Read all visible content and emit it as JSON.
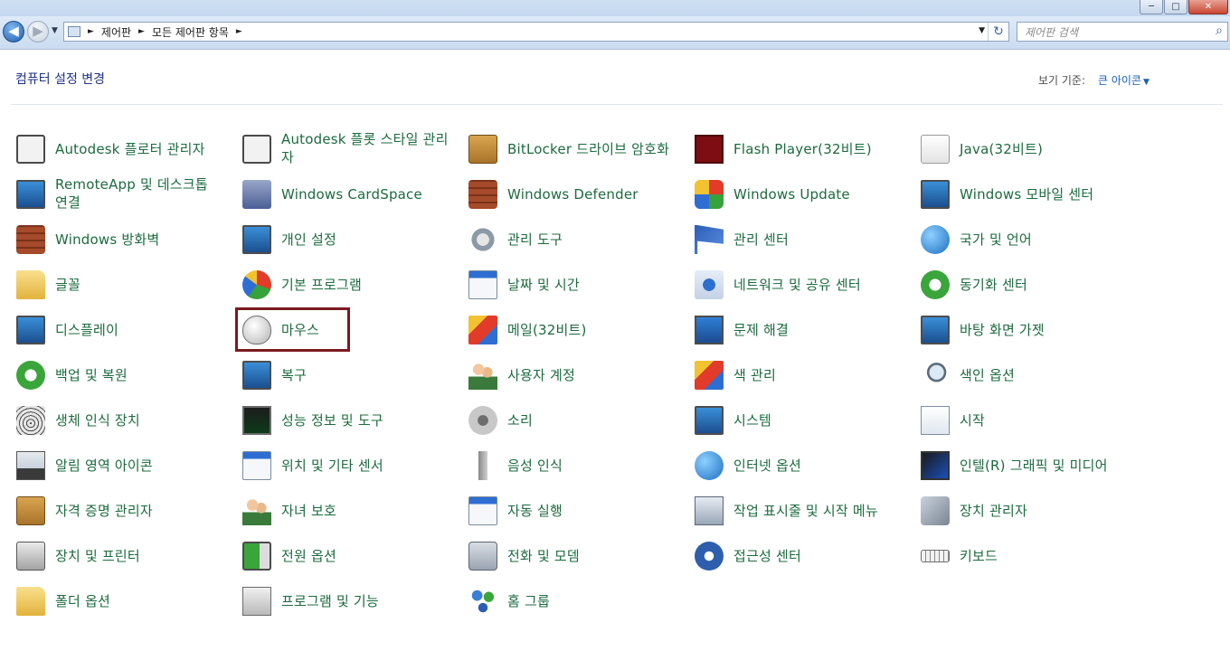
{
  "window": {
    "min_label": "─",
    "max_label": "□",
    "close_label": "✕"
  },
  "nav": {
    "back_glyph": "◀",
    "forward_glyph": "▶",
    "history_glyph": "▼",
    "breadcrumb": [
      "제어판",
      "모든 제어판 항목"
    ],
    "crumb_sep": "►",
    "refresh_glyph": "↻",
    "dropdown_glyph": "▼"
  },
  "search": {
    "placeholder": "제어판 검색",
    "icon": "magnifier-icon"
  },
  "header": {
    "title": "컴퓨터 설정 변경",
    "view_by_label": "보기 기준:",
    "view_by_value": "큰 아이콘"
  },
  "items": [
    {
      "label": "Autodesk 플로터 관리자",
      "icon": "printer-icon"
    },
    {
      "label": "Autodesk 플롯 스타일 관리자",
      "icon": "plot-style-icon"
    },
    {
      "label": "BitLocker 드라이브 암호화",
      "icon": "bitlocker-icon"
    },
    {
      "label": "Flash Player(32비트)",
      "icon": "flash-icon"
    },
    {
      "label": "Java(32비트)",
      "icon": "java-icon"
    },
    {
      "label": "RemoteApp 및 데스크톱 연결",
      "icon": "remoteapp-icon"
    },
    {
      "label": "Windows CardSpace",
      "icon": "cardspace-icon"
    },
    {
      "label": "Windows Defender",
      "icon": "defender-icon"
    },
    {
      "label": "Windows Update",
      "icon": "windows-update-icon"
    },
    {
      "label": "Windows 모바일 센터",
      "icon": "mobility-center-icon"
    },
    {
      "label": "Windows 방화벽",
      "icon": "firewall-icon"
    },
    {
      "label": "개인 설정",
      "icon": "personalization-icon"
    },
    {
      "label": "관리 도구",
      "icon": "admin-tools-icon"
    },
    {
      "label": "관리 센터",
      "icon": "action-center-flag-icon"
    },
    {
      "label": "국가 및 언어",
      "icon": "region-globe-icon"
    },
    {
      "label": "글꼴",
      "icon": "fonts-folder-icon"
    },
    {
      "label": "기본 프로그램",
      "icon": "default-programs-icon"
    },
    {
      "label": "날짜 및 시간",
      "icon": "calendar-clock-icon"
    },
    {
      "label": "네트워크 및 공유 센터",
      "icon": "network-icon"
    },
    {
      "label": "동기화 센터",
      "icon": "sync-icon"
    },
    {
      "label": "디스플레이",
      "icon": "display-icon"
    },
    {
      "label": "마우스",
      "icon": "mouse-icon"
    },
    {
      "label": "메일(32비트)",
      "icon": "mail-icon"
    },
    {
      "label": "문제 해결",
      "icon": "troubleshooting-icon"
    },
    {
      "label": "바탕 화면 가젯",
      "icon": "gadgets-icon"
    },
    {
      "label": "백업 및 복원",
      "icon": "backup-icon"
    },
    {
      "label": "복구",
      "icon": "recovery-icon"
    },
    {
      "label": "사용자 계정",
      "icon": "user-accounts-icon"
    },
    {
      "label": "색 관리",
      "icon": "color-management-icon"
    },
    {
      "label": "색인 옵션",
      "icon": "indexing-icon"
    },
    {
      "label": "생체 인식 장치",
      "icon": "biometric-icon"
    },
    {
      "label": "성능 정보 및 도구",
      "icon": "performance-icon"
    },
    {
      "label": "소리",
      "icon": "sound-icon"
    },
    {
      "label": "시스템",
      "icon": "system-icon"
    },
    {
      "label": "시작",
      "icon": "getting-started-icon"
    },
    {
      "label": "알림 영역 아이콘",
      "icon": "notification-icon"
    },
    {
      "label": "위치 및 기타 센서",
      "icon": "sensor-icon"
    },
    {
      "label": "음성 인식",
      "icon": "microphone-icon"
    },
    {
      "label": "인터넷 옵션",
      "icon": "internet-options-icon"
    },
    {
      "label": "인텔(R) 그래픽 및 미디어",
      "icon": "intel-graphics-icon"
    },
    {
      "label": "자격 증명 관리자",
      "icon": "credential-manager-icon"
    },
    {
      "label": "자녀 보호",
      "icon": "parental-controls-icon"
    },
    {
      "label": "자동 실행",
      "icon": "autoplay-icon"
    },
    {
      "label": "작업 표시줄 및 시작 메뉴",
      "icon": "taskbar-icon"
    },
    {
      "label": "장치 관리자",
      "icon": "device-manager-icon"
    },
    {
      "label": "장치 및 프린터",
      "icon": "devices-printers-icon"
    },
    {
      "label": "전원 옵션",
      "icon": "power-options-icon"
    },
    {
      "label": "전화 및 모뎀",
      "icon": "phone-modem-icon"
    },
    {
      "label": "접근성 센터",
      "icon": "ease-of-access-icon"
    },
    {
      "label": "키보드",
      "icon": "keyboard-icon"
    },
    {
      "label": "폴더 옵션",
      "icon": "folder-options-icon"
    },
    {
      "label": "프로그램 및 기능",
      "icon": "programs-features-icon"
    },
    {
      "label": "홈 그룹",
      "icon": "homegroup-icon"
    }
  ],
  "highlighted_item": "마우스"
}
